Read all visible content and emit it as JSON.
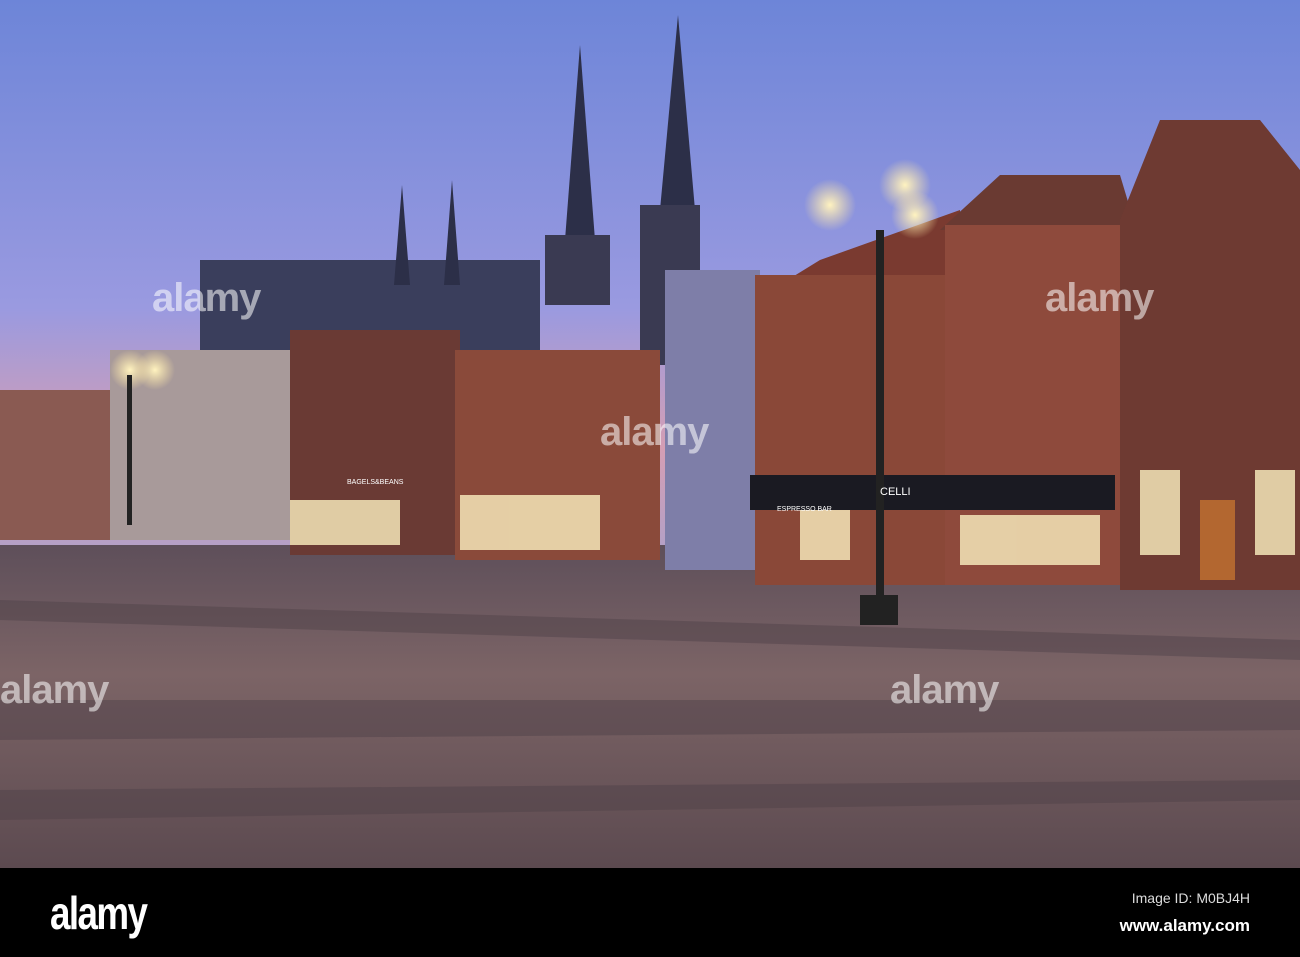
{
  "footer": {
    "logo": "alamy",
    "image_id": "Image ID: M0BJ4H",
    "website": "www.alamy.com"
  },
  "watermark": "alamy",
  "signs": {
    "espresso": "ESPRESSO BAR",
    "bagels": "BAGELS&BEANS",
    "celli": "CELLI"
  },
  "colors": {
    "sky_top": "#6f86d6",
    "sky_horizon": "#d59bb0",
    "pavement": "#6e5a5e",
    "brick": "#8a4a3a",
    "lamp_glow": "#ffe6a0"
  }
}
